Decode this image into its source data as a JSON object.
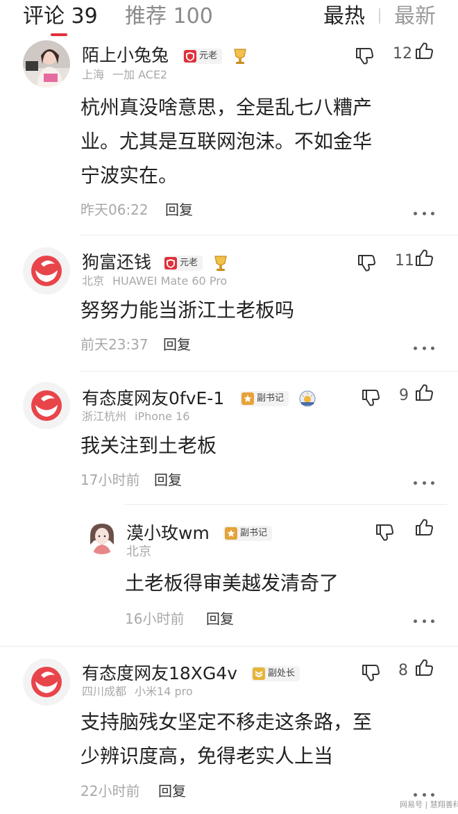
{
  "header": {
    "tabs": [
      {
        "label": "评论 39"
      },
      {
        "label": "推荐 100"
      }
    ],
    "sort": {
      "hot": "最热",
      "new": "最新"
    }
  },
  "comments": [
    {
      "name": "陌上小兔兔",
      "badge": "元老",
      "meta": [
        "上海",
        "一加 ACE2"
      ],
      "text": [
        "杭州真没啥意思，全是乱七八糟产",
        "业。尤其是互联网泡沫。不如金华",
        "宁波实在。"
      ],
      "time": "昨天06:22",
      "reply": "回复",
      "likes": "12"
    },
    {
      "name": "狗富还钱",
      "badge": "元老",
      "meta": [
        "北京",
        "HUAWEI Mate 60 Pro"
      ],
      "text": [
        "努努力能当浙江土老板吗"
      ],
      "time": "前天23:37",
      "reply": "回复",
      "likes": "11"
    },
    {
      "name": "有态度网友0fvE-1",
      "badge": "副书记",
      "meta": [
        "浙江杭州",
        "iPhone 16"
      ],
      "text": [
        "我关注到土老板"
      ],
      "time": "17小时前",
      "reply": "回复",
      "likes": "9"
    },
    {
      "name": "漠小玫wm",
      "badge": "副书记",
      "meta": [
        "北京"
      ],
      "text": [
        "土老板得审美越发清奇了"
      ],
      "time": "16小时前",
      "reply": "回复",
      "likes": ""
    },
    {
      "name": "有态度网友18XG4v",
      "badge": "副处长",
      "meta": [
        "四川成都",
        "小米14 pro"
      ],
      "text": [
        "支持脑残女坚定不移走这条路，至",
        "少辨识度高，免得老实人上当"
      ],
      "time": "22小时前",
      "reply": "回复",
      "likes": "8"
    }
  ],
  "watermark": "网易号 | 慧翔善科",
  "colors": {
    "accent": "#e0303a",
    "netease_red": "#e8454b",
    "gold": "#e6a33a"
  }
}
